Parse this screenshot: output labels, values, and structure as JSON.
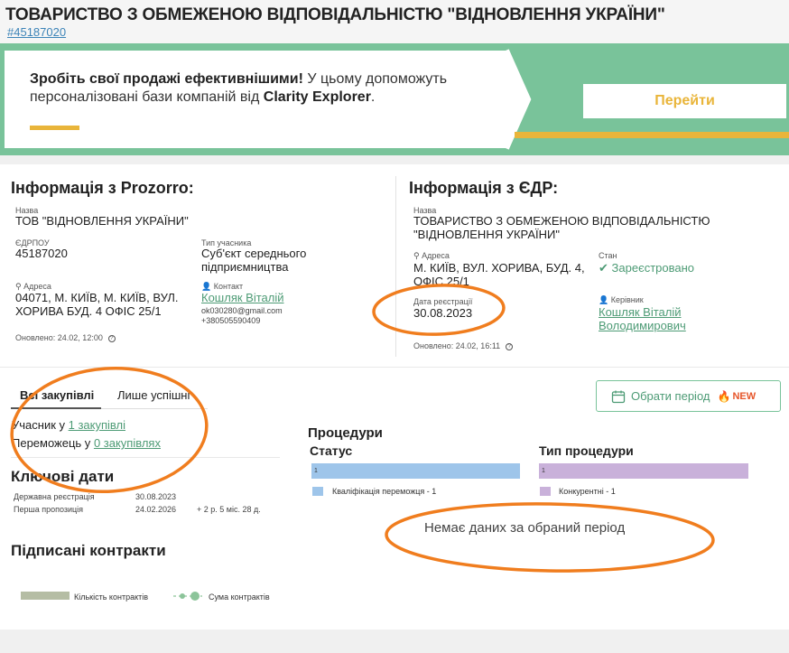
{
  "header": {
    "title": "ТОВАРИСТВО З ОБМЕЖЕНОЮ ВІДПОВІДАЛЬНІСТЮ \"ВІДНОВЛЕННЯ УКРАЇНИ\"",
    "id_link": "#45187020"
  },
  "banner": {
    "bold_text": "Зробіть свої продажі ефективнішими!",
    "text": " У цьому допоможуть персоналізовані бази компаній від ",
    "brand": "Clarity Explorer",
    "end": ".",
    "button": "Перейти"
  },
  "prozorro": {
    "title": "Інформація з Prozorro:",
    "name_label": "Назва",
    "name": "ТОВ \"ВІДНОВЛЕННЯ УКРАЇНИ\"",
    "edrpou_label": "ЄДРПОУ",
    "edrpou": "45187020",
    "type_label": "Тип учасника",
    "type": "Суб'єкт середнього підприємництва",
    "address_label": "Адреса",
    "address": "04071, М. КИЇВ, М. КИЇВ, ВУЛ. ХОРИВА БУД. 4 ОФІС 25/1",
    "contact_label": "Контакт",
    "contact_name": "Кошляк Віталій",
    "contact_email": "ok030280@gmail.com",
    "contact_phone": "+380505590409",
    "updated": "Оновлено: 24.02, 12:00"
  },
  "edr": {
    "title": "Інформація з ЄДР:",
    "name_label": "Назва",
    "name": "ТОВАРИСТВО З ОБМЕЖЕНОЮ ВІДПОВІДАЛЬНІСТЮ \"ВІДНОВЛЕННЯ УКРАЇНИ\"",
    "address_label": "Адреса",
    "address": "М. КИЇВ, ВУЛ. ХОРИВА, БУД. 4, ОФІС 25/1",
    "state_label": "Стан",
    "state": "Зареєстровано",
    "reg_date_label": "Дата реєстрації",
    "reg_date": "30.08.2023",
    "head_label": "Керівник",
    "head": "Кошляк Віталій Володимирович",
    "updated": "Оновлено: 24.02, 16:11"
  },
  "tabs": {
    "all": "Всі закупівлі",
    "success": "Лише успішні"
  },
  "period_button": {
    "label": "Обрати період",
    "badge": "NEW"
  },
  "participation": {
    "participant_prefix": "Учасник у ",
    "participant_link": "1 закупівлі",
    "winner_prefix": "Переможець у ",
    "winner_link": "0 закупівлях"
  },
  "key_dates": {
    "title": "Ключові дати",
    "rows": [
      {
        "label": "Державна реєстрація",
        "date": "30.08.2023",
        "note": ""
      },
      {
        "label": "Перша пропозиція",
        "date": "24.02.2026",
        "note": "+ 2 р. 5 міс. 28 д."
      }
    ]
  },
  "procedures": {
    "title": "Процедури",
    "status_title": "Статус",
    "type_title": "Тип процедури",
    "status_bar_value": "1",
    "type_bar_value": "1",
    "status_legend": "Кваліфікація переможця - 1",
    "type_legend": "Конкурентні - 1",
    "no_data": "Немає даних за обраний період"
  },
  "contracts": {
    "title": "Підписані контракти",
    "legend_count": "Кількість контрактів",
    "legend_sum": "Сума контрактів"
  },
  "colors": {
    "green": "#79c39a",
    "accent": "#e9b53a",
    "link": "#4d9b75",
    "annotation": "#f07d1e",
    "status_bar": "#9ec5ea",
    "type_bar": "#c9b1da"
  }
}
